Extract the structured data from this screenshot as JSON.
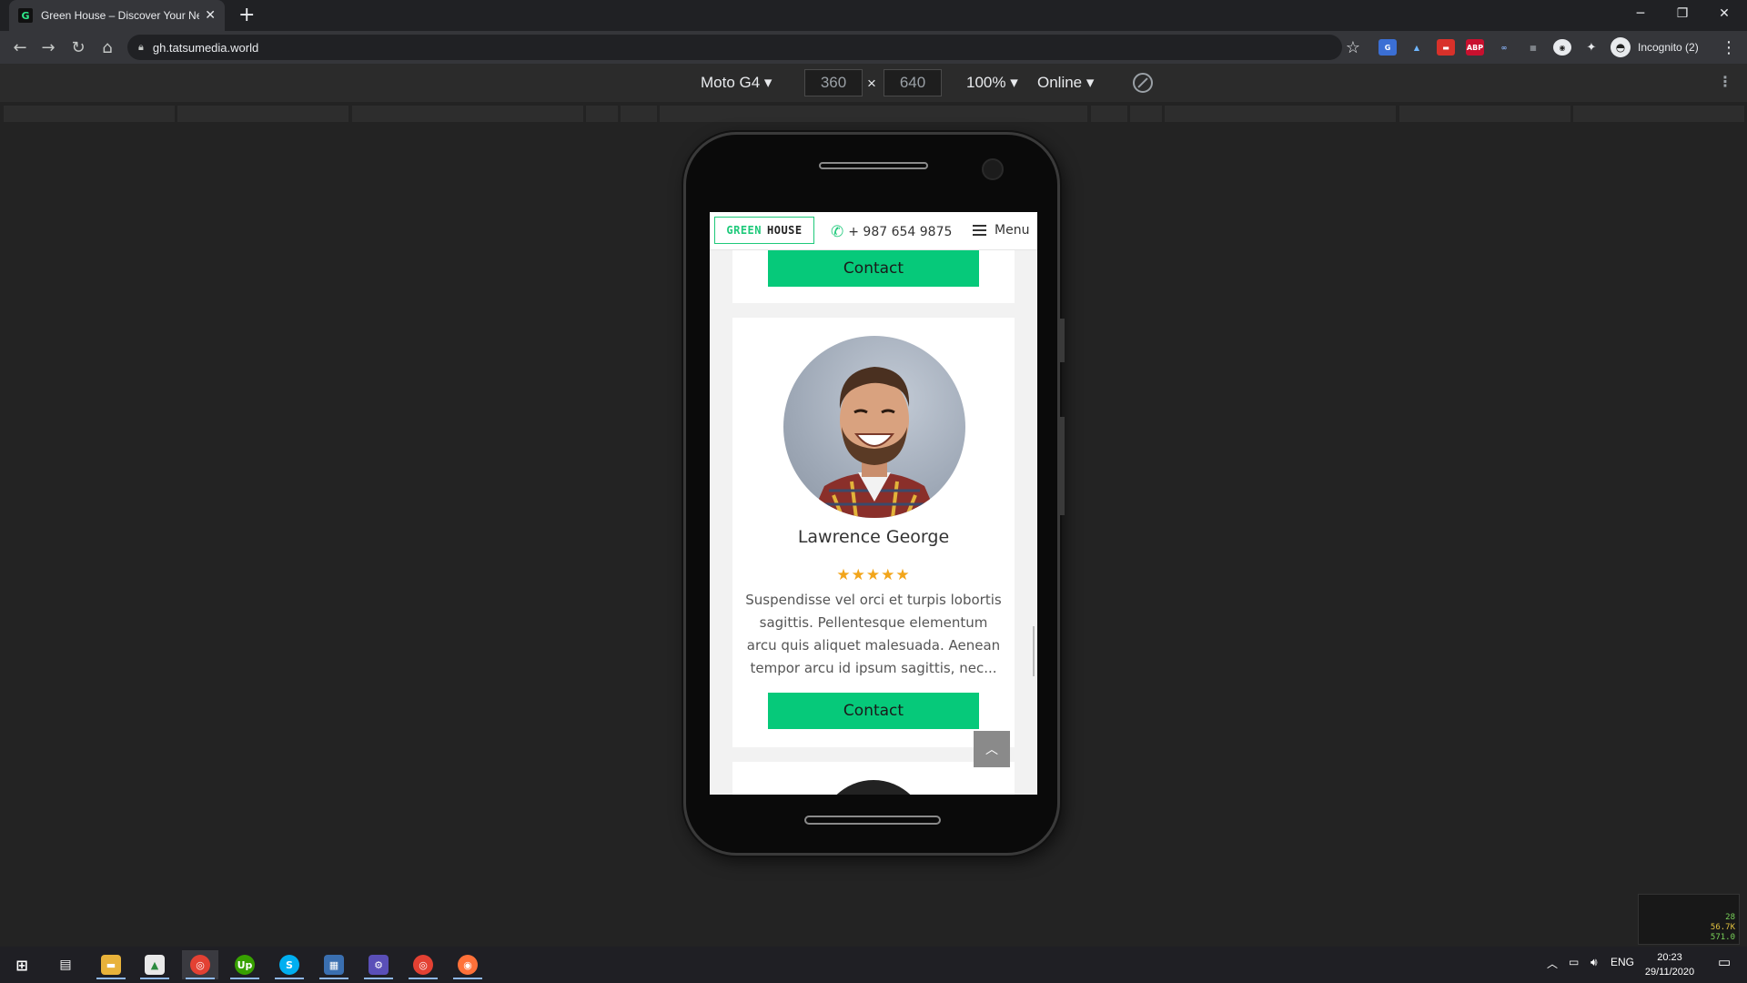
{
  "browser": {
    "tab_title": "Green House – Discover Your Ne",
    "tab_favicon": "G",
    "url": "gh.tatsumedia.world",
    "profile_label": "Incognito (2)"
  },
  "devtools": {
    "device": "Moto G4",
    "width": "360",
    "times": "×",
    "height": "640",
    "zoom": "100%",
    "network": "Online"
  },
  "site": {
    "logo_green": "GREEN",
    "logo_dark": "HOUSE",
    "phone": "+ 987 654 9875",
    "menu_label": "Menu",
    "contact_label": "Contact",
    "person": {
      "name": "Lawrence George",
      "rating": 5,
      "stars": "★★★★★",
      "bio": "Suspendisse vel orci et turpis lobortis sagittis. Pellentesque elementum arcu quis aliquet malesuada. Aenean tempor arcu id ipsum sagittis, nec..."
    }
  },
  "taskbar": {
    "lang": "ENG",
    "time": "20:23",
    "date": "29/11/2020"
  },
  "widget": {
    "v1": "28",
    "v2": "56.7K",
    "v3": "571.0"
  },
  "colors": {
    "accent": "#06c97a",
    "star": "#f2a51a"
  }
}
